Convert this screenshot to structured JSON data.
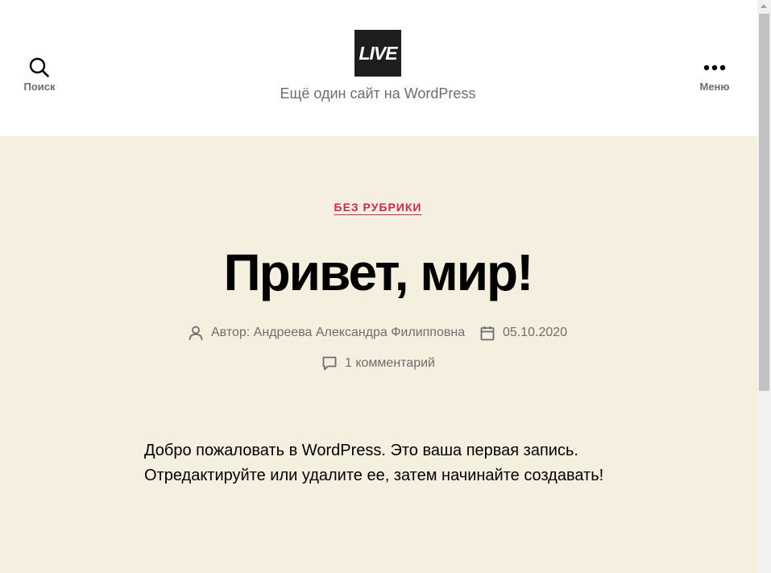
{
  "header": {
    "search_label": "Поиск",
    "menu_label": "Меню",
    "logo_text": "LIVE",
    "site_description": "Ещё один сайт на WordPress"
  },
  "post": {
    "category": "БЕЗ РУБРИКИ",
    "title": "Привет, мир!",
    "author_line": "Автор: Андреева Александра Филипповна",
    "date": "05.10.2020",
    "comments": "1 комментарий",
    "content": "Добро пожаловать в WordPress. Это ваша первая запись. Отредактируйте или удалите ее, затем начинайте создавать!"
  },
  "icons": {
    "search": "search-icon",
    "menu": "ellipsis-icon",
    "author": "user-icon",
    "date": "calendar-icon",
    "comments": "comment-icon"
  },
  "colors": {
    "accent": "#cd2653",
    "background": "#f5efe0",
    "header_bg": "#ffffff",
    "meta_text": "#6d6d6d"
  }
}
